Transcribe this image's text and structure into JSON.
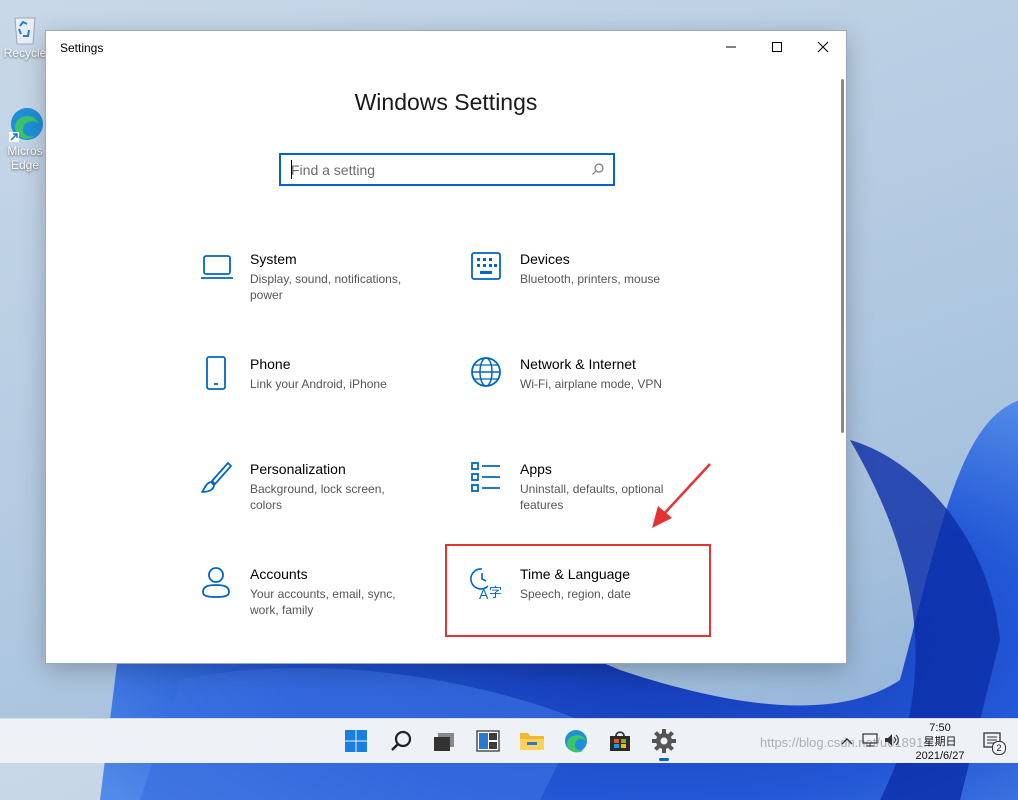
{
  "desktop": {
    "icons": [
      {
        "name": "recycle-bin",
        "label": "Recycle"
      },
      {
        "name": "microsoft-edge",
        "label_line1": "Micros",
        "label_line2": "Edge"
      }
    ]
  },
  "window": {
    "title": "Settings",
    "heading": "Windows Settings",
    "search": {
      "placeholder": "Find a setting",
      "value": ""
    },
    "tiles": [
      {
        "key": "system",
        "title": "System",
        "desc": "Display, sound, notifications, power",
        "icon": "laptop-icon"
      },
      {
        "key": "devices",
        "title": "Devices",
        "desc": "Bluetooth, printers, mouse",
        "icon": "keyboard-icon"
      },
      {
        "key": "phone",
        "title": "Phone",
        "desc": "Link your Android, iPhone",
        "icon": "phone-icon"
      },
      {
        "key": "network",
        "title": "Network & Internet",
        "desc": "Wi-Fi, airplane mode, VPN",
        "icon": "globe-icon"
      },
      {
        "key": "personalization",
        "title": "Personalization",
        "desc": "Background, lock screen, colors",
        "icon": "paintbrush-icon"
      },
      {
        "key": "apps",
        "title": "Apps",
        "desc": "Uninstall, defaults, optional features",
        "icon": "apps-list-icon"
      },
      {
        "key": "accounts",
        "title": "Accounts",
        "desc": "Your accounts, email, sync, work, family",
        "icon": "person-icon"
      },
      {
        "key": "time-language",
        "title": "Time & Language",
        "desc": "Speech, region, date",
        "icon": "time-language-icon"
      }
    ]
  },
  "taskbar": {
    "apps": [
      "start",
      "search",
      "task-view",
      "widgets",
      "file-explorer",
      "edge",
      "store",
      "settings"
    ],
    "active": "settings",
    "clock": {
      "time": "7:50",
      "day": "星期日",
      "date": "2021/6/27"
    },
    "notification_count": "2",
    "watermark": "https://blog.csdn.net/u01891..."
  },
  "colors": {
    "accent": "#0067c0",
    "highlight": "#e53333"
  }
}
